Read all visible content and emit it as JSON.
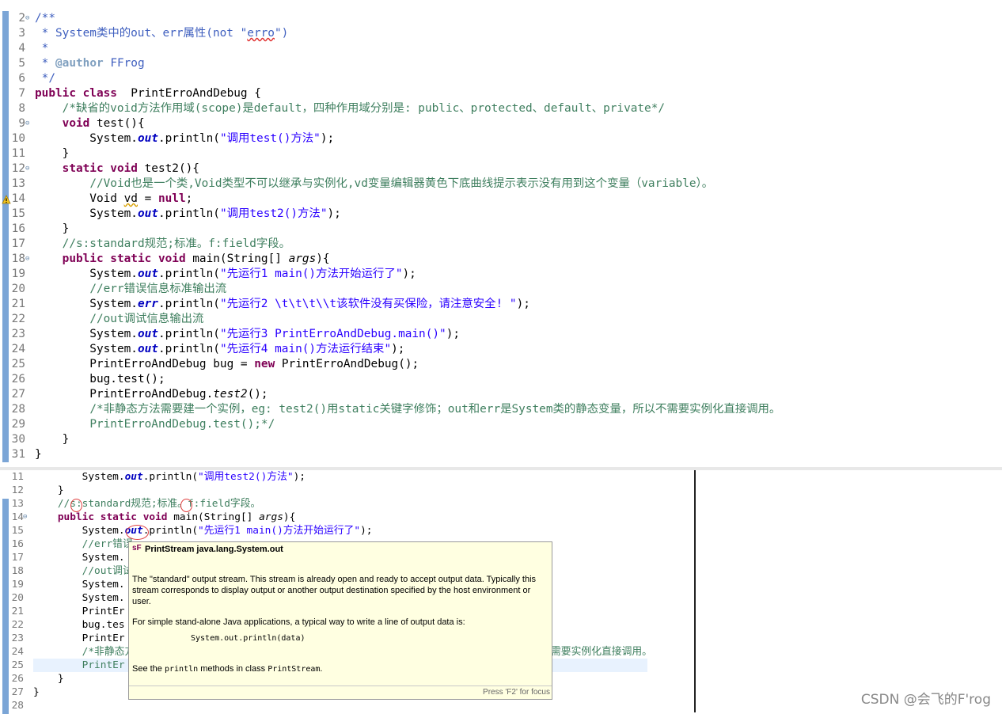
{
  "editor_top": {
    "lines": [
      {
        "n": "2",
        "fold": true,
        "parts": [
          [
            "jd",
            "/**"
          ]
        ]
      },
      {
        "n": "3",
        "parts": [
          [
            "jd",
            " * System类中的out、err属性(not \""
          ],
          [
            "jd sqr",
            "erro"
          ],
          [
            "jd",
            "\")"
          ]
        ]
      },
      {
        "n": "4",
        "parts": [
          [
            "jd",
            " *"
          ]
        ]
      },
      {
        "n": "5",
        "parts": [
          [
            "jd",
            " * "
          ],
          [
            "tag",
            "@author"
          ],
          [
            "jd",
            " FFrog"
          ]
        ]
      },
      {
        "n": "6",
        "parts": [
          [
            "jd",
            " */"
          ]
        ]
      },
      {
        "n": "7",
        "parts": [
          [
            "kw",
            "public class"
          ],
          [
            "",
            "  PrintErroAndDebug {"
          ]
        ]
      },
      {
        "n": "8",
        "parts": [
          [
            "",
            "    "
          ],
          [
            "cm",
            "/*缺省的void方法作用域(scope)是default，四种作用域分别是: public、protected、default、private*/"
          ]
        ]
      },
      {
        "n": "9",
        "fold": true,
        "parts": [
          [
            "",
            "    "
          ],
          [
            "kw",
            "void"
          ],
          [
            "",
            " test(){"
          ]
        ]
      },
      {
        "n": "10",
        "parts": [
          [
            "",
            "        System."
          ],
          [
            "fld",
            "out"
          ],
          [
            "",
            ".println("
          ],
          [
            "st",
            "\"调用test()方法\""
          ],
          [
            "",
            ");"
          ]
        ]
      },
      {
        "n": "11",
        "parts": [
          [
            "",
            "    }"
          ]
        ]
      },
      {
        "n": "12",
        "fold": true,
        "parts": [
          [
            "",
            "    "
          ],
          [
            "kw",
            "static void"
          ],
          [
            "",
            " test2(){"
          ]
        ]
      },
      {
        "n": "13",
        "parts": [
          [
            "",
            "        "
          ],
          [
            "cm",
            "//Void也是一个类,Void类型不可以继承与实例化,vd变量编辑器黄色下底曲线提示表示没有用到这个变量（variable）。"
          ]
        ]
      },
      {
        "n": "14",
        "parts": [
          [
            "",
            "        Void "
          ],
          [
            "sq",
            "vd"
          ],
          [
            "",
            " = "
          ],
          [
            "kw",
            "null"
          ],
          [
            "",
            ";"
          ]
        ]
      },
      {
        "n": "15",
        "parts": [
          [
            "",
            "        System."
          ],
          [
            "fld",
            "out"
          ],
          [
            "",
            ".println("
          ],
          [
            "st",
            "\"调用test2()方法\""
          ],
          [
            "",
            ");"
          ]
        ]
      },
      {
        "n": "16",
        "parts": [
          [
            "",
            "    }"
          ]
        ]
      },
      {
        "n": "17",
        "parts": [
          [
            "",
            "    "
          ],
          [
            "cm",
            "//s:standard规范;标准。f:field字段。"
          ]
        ]
      },
      {
        "n": "18",
        "fold": true,
        "parts": [
          [
            "",
            "    "
          ],
          [
            "kw",
            "public static void"
          ],
          [
            "",
            " main(String[] "
          ],
          [
            "it",
            "args"
          ],
          [
            "",
            "){"
          ]
        ]
      },
      {
        "n": "19",
        "parts": [
          [
            "",
            "        System."
          ],
          [
            "fld",
            "out"
          ],
          [
            "",
            ".println("
          ],
          [
            "st",
            "\"先运行1 main()方法开始运行了\""
          ],
          [
            "",
            ");"
          ]
        ]
      },
      {
        "n": "20",
        "parts": [
          [
            "",
            "        "
          ],
          [
            "cm",
            "//err错误信息标准输出流"
          ]
        ]
      },
      {
        "n": "21",
        "parts": [
          [
            "",
            "        System."
          ],
          [
            "fld",
            "err"
          ],
          [
            "",
            ".println("
          ],
          [
            "st",
            "\"先运行2 \\t\\t\\t\\\\t该软件没有买保险，请注意安全! \""
          ],
          [
            "",
            ");"
          ]
        ]
      },
      {
        "n": "22",
        "parts": [
          [
            "",
            "        "
          ],
          [
            "cm",
            "//out调试信息输出流"
          ]
        ]
      },
      {
        "n": "23",
        "parts": [
          [
            "",
            "        System."
          ],
          [
            "fld",
            "out"
          ],
          [
            "",
            ".println("
          ],
          [
            "st",
            "\"先运行3 PrintErroAndDebug.main()\""
          ],
          [
            "",
            ");"
          ]
        ]
      },
      {
        "n": "24",
        "parts": [
          [
            "",
            "        System."
          ],
          [
            "fld",
            "out"
          ],
          [
            "",
            ".println("
          ],
          [
            "st",
            "\"先运行4 main()方法运行结束\""
          ],
          [
            "",
            ");"
          ]
        ]
      },
      {
        "n": "25",
        "parts": [
          [
            "",
            "        PrintErroAndDebug bug = "
          ],
          [
            "kw",
            "new"
          ],
          [
            "",
            " PrintErroAndDebug();"
          ]
        ]
      },
      {
        "n": "26",
        "parts": [
          [
            "",
            "        bug.test();"
          ]
        ]
      },
      {
        "n": "27",
        "parts": [
          [
            "",
            "        PrintErroAndDebug."
          ],
          [
            "it",
            "test2"
          ],
          [
            "",
            "();"
          ]
        ]
      },
      {
        "n": "28",
        "parts": [
          [
            "",
            "        "
          ],
          [
            "cm",
            "/*非静态方法需要建一个实例，eg: test2()用static关键字修饰；out和err是System类的静态变量，所以不需要实例化直接调用。"
          ]
        ]
      },
      {
        "n": "29",
        "parts": [
          [
            "",
            "        "
          ],
          [
            "cm",
            "PrintErroAndDebug.test();*/"
          ]
        ]
      },
      {
        "n": "30",
        "parts": [
          [
            "",
            "    }"
          ]
        ]
      },
      {
        "n": "31",
        "parts": [
          [
            "",
            "}"
          ]
        ]
      }
    ]
  },
  "editor_bottom": {
    "lines": [
      {
        "n": "11",
        "parts": [
          [
            "",
            "        System."
          ],
          [
            "fld",
            "out"
          ],
          [
            "",
            ".println("
          ],
          [
            "st",
            "\"调用test2()方法\""
          ],
          [
            "",
            ");"
          ]
        ]
      },
      {
        "n": "12",
        "parts": [
          [
            "",
            "    }"
          ]
        ]
      },
      {
        "n": "13",
        "parts": [
          [
            "",
            "    "
          ],
          [
            "cm",
            "//s:standard规范;标准。f:field字段。"
          ]
        ]
      },
      {
        "n": "14",
        "fold": true,
        "parts": [
          [
            "",
            "    "
          ],
          [
            "kw",
            "public static void"
          ],
          [
            "",
            " main(String[] "
          ],
          [
            "it",
            "args"
          ],
          [
            "",
            "){"
          ]
        ]
      },
      {
        "n": "15",
        "parts": [
          [
            "",
            "        System."
          ],
          [
            "fld",
            "out"
          ],
          [
            "",
            ".println("
          ],
          [
            "st",
            "\"先运行1 main()方法开始运行了\""
          ],
          [
            "",
            ");"
          ]
        ]
      },
      {
        "n": "16",
        "parts": [
          [
            "",
            "        "
          ],
          [
            "cm",
            "//err错误"
          ]
        ]
      },
      {
        "n": "17",
        "parts": [
          [
            "",
            "        System."
          ]
        ]
      },
      {
        "n": "18",
        "parts": [
          [
            "",
            "        "
          ],
          [
            "cm",
            "//out调试"
          ]
        ]
      },
      {
        "n": "19",
        "parts": [
          [
            "",
            "        System."
          ]
        ]
      },
      {
        "n": "20",
        "parts": [
          [
            "",
            "        System."
          ]
        ]
      },
      {
        "n": "21",
        "parts": [
          [
            "",
            "        PrintEr"
          ]
        ]
      },
      {
        "n": "22",
        "parts": [
          [
            "",
            "        bug.tes"
          ]
        ]
      },
      {
        "n": "23",
        "parts": [
          [
            "",
            "        PrintEr"
          ]
        ]
      },
      {
        "n": "24",
        "parts": [
          [
            "",
            "        "
          ],
          [
            "cm",
            "/*非静态方"
          ]
        ],
        "tail": "需要实例化直接调用。"
      },
      {
        "n": "25",
        "parts": [
          [
            "",
            "        "
          ],
          [
            "cm",
            "PrintEr"
          ]
        ],
        "current": true
      },
      {
        "n": "26",
        "parts": [
          [
            "",
            "    }"
          ]
        ]
      },
      {
        "n": "27",
        "parts": [
          [
            "",
            "}"
          ]
        ]
      },
      {
        "n": "28",
        "parts": []
      }
    ]
  },
  "tooltip": {
    "icon": "sF",
    "title": "PrintStream java.lang.System.out",
    "p1": "The \"standard\" output stream. This stream is already open and ready to accept output data. Typically this stream corresponds to display output or another output destination specified by the host environment or user.",
    "p2": "For simple stand-alone Java applications, a typical way to write a line of output data is:",
    "code": "System.out.println(data)",
    "p3_pre": "See the ",
    "p3_code1": "println",
    "p3_mid": " methods in class ",
    "p3_code2": "PrintStream",
    "p3_post": ".",
    "footer": "Press 'F2' for focus"
  },
  "watermark": "CSDN @会飞的F'rog"
}
